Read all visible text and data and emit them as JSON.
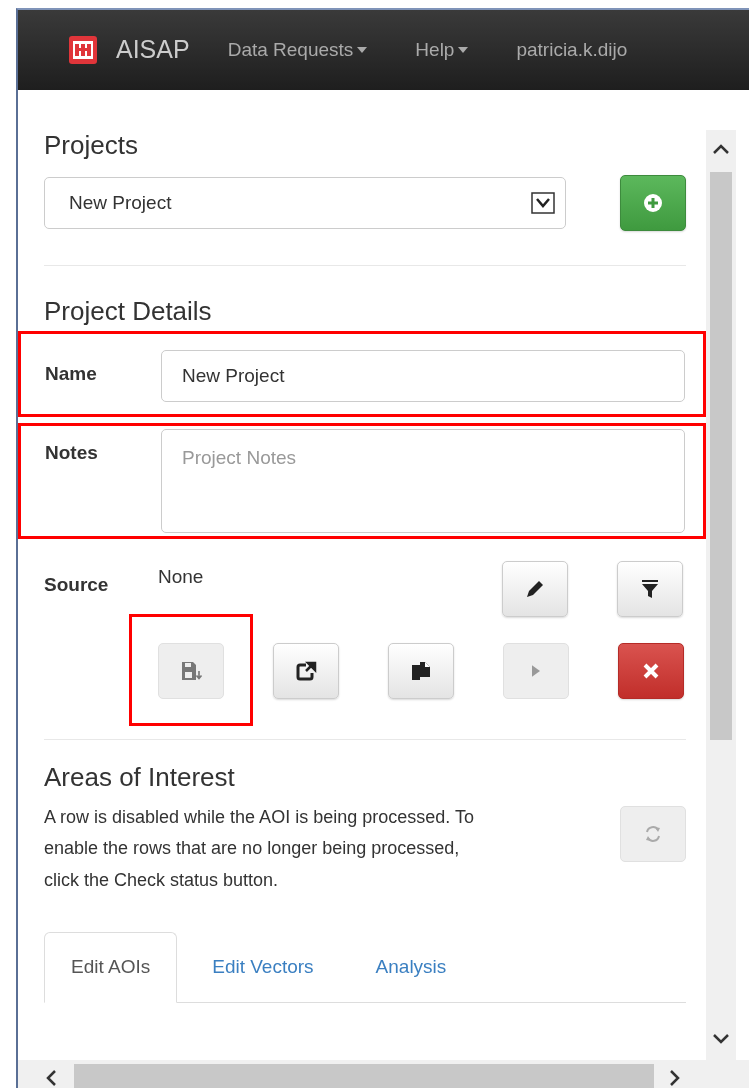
{
  "navbar": {
    "brand": "AISAP",
    "menus": [
      {
        "label": "Data Requests",
        "dropdown": true
      },
      {
        "label": "Help",
        "dropdown": true
      },
      {
        "label": "patricia.k.dijo",
        "dropdown": false
      }
    ]
  },
  "projects": {
    "heading": "Projects",
    "select_value": "New Project"
  },
  "details": {
    "heading": "Project Details",
    "fields": [
      {
        "label": "Name",
        "value": "New Project",
        "kind": "input",
        "highlighted": true
      },
      {
        "label": "Notes",
        "placeholder": "Project Notes",
        "kind": "textarea",
        "highlighted": true
      }
    ],
    "source": {
      "label": "Source",
      "value": "None"
    },
    "source_buttons": [
      {
        "kind": "edit",
        "disabled": false
      },
      {
        "kind": "filter",
        "disabled": false
      }
    ],
    "action_buttons": [
      {
        "kind": "save",
        "disabled": true,
        "highlighted": true
      },
      {
        "kind": "share",
        "disabled": false,
        "highlighted": false
      },
      {
        "kind": "copy",
        "disabled": false,
        "highlighted": false
      },
      {
        "kind": "play",
        "disabled": true,
        "highlighted": false
      },
      {
        "kind": "delete",
        "disabled": false,
        "highlighted": false
      }
    ]
  },
  "aoi": {
    "heading": "Areas of Interest",
    "text": "A row is disabled while the AOI is being processed. To enable the rows that are no longer being processed, click the Check status button.",
    "refresh_disabled": true,
    "tabs": [
      {
        "label": "Edit AOIs",
        "selected": true
      },
      {
        "label": "Edit Vectors",
        "selected": false
      },
      {
        "label": "Analysis",
        "selected": false
      }
    ]
  }
}
